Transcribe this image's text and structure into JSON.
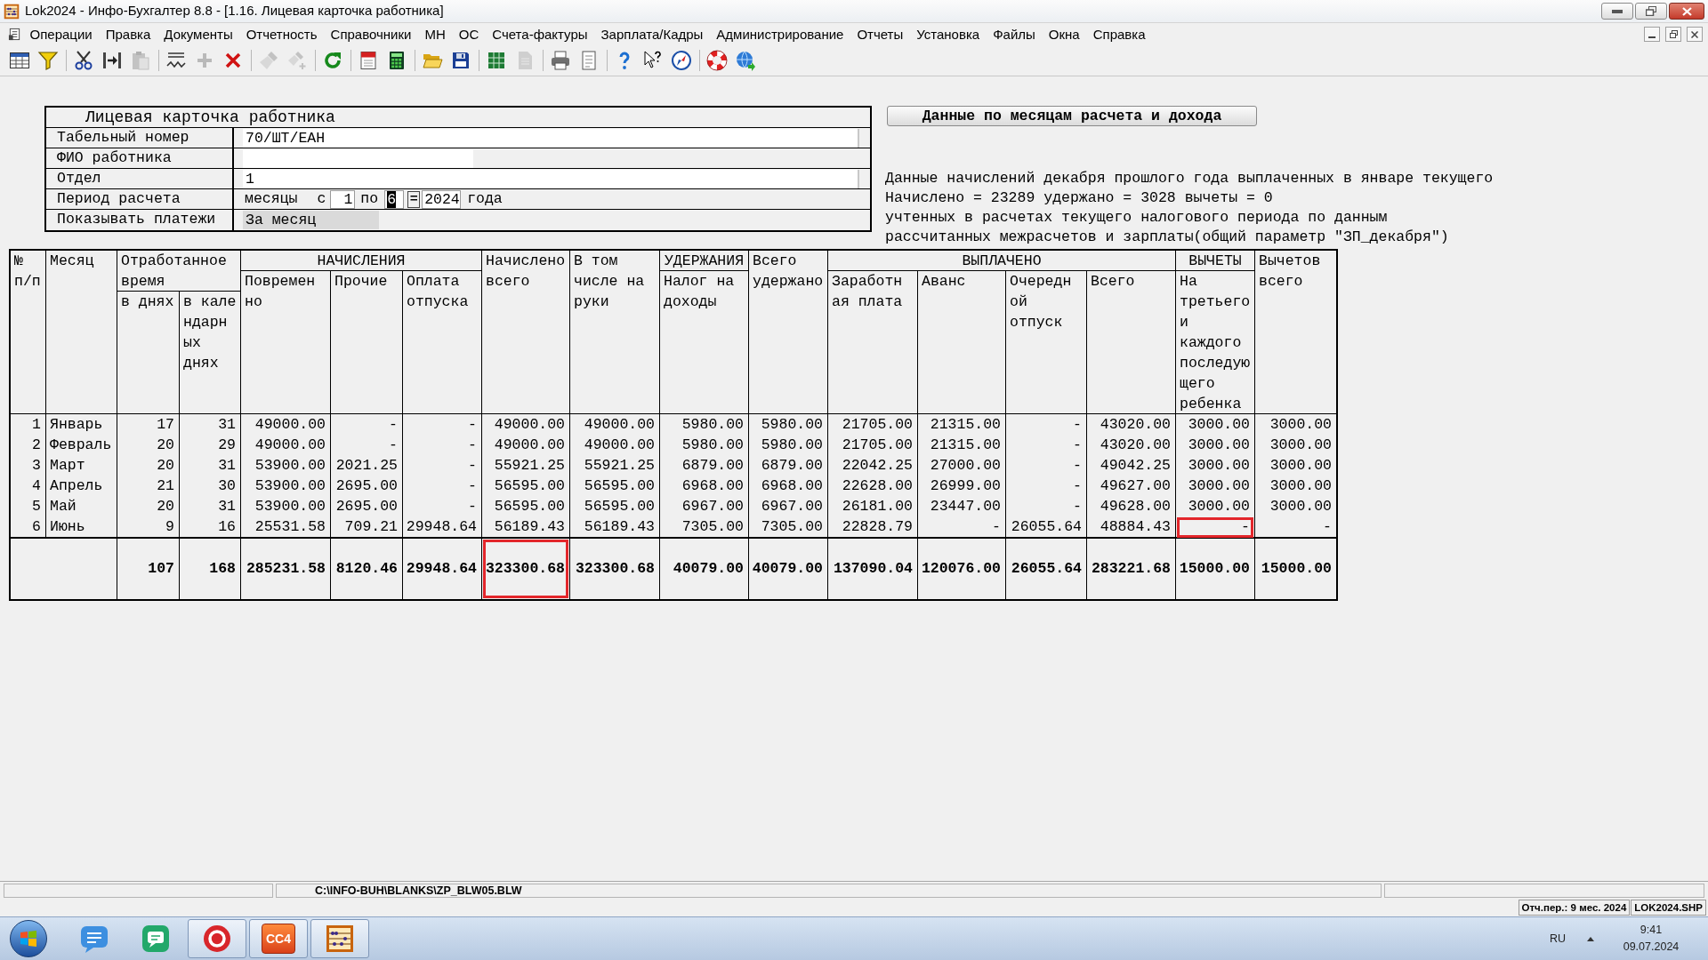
{
  "window": {
    "title": "Lok2024 - Инфо-Бухгалтер 8.8 - [1.16. Лицевая карточка работника]"
  },
  "menu": [
    "Операции",
    "Правка",
    "Документы",
    "Отчетность",
    "Справочники",
    "МН",
    "ОС",
    "Счета-фактуры",
    "Зарплата/Кадры",
    "Администрирование",
    "Отчеты",
    "Установка",
    "Файлы",
    "Окна",
    "Справка"
  ],
  "toolbar": {
    "groups": [
      [
        {
          "disabled": false
        },
        {
          "disabled": false
        }
      ],
      [
        {
          "disabled": false
        },
        {
          "disabled": false
        },
        {
          "disabled": true
        }
      ],
      [
        {
          "disabled": false
        },
        {
          "disabled": true
        },
        {
          "disabled": false
        }
      ],
      [
        {
          "disabled": true
        },
        {
          "disabled": true
        }
      ],
      [
        {
          "disabled": false
        }
      ],
      [
        {
          "disabled": false
        },
        {
          "disabled": false
        }
      ],
      [
        {
          "disabled": false
        },
        {
          "disabled": false
        }
      ],
      [
        {
          "disabled": false
        },
        {
          "disabled": true
        }
      ],
      [
        {
          "disabled": false
        },
        {
          "disabled": false
        }
      ],
      [
        {
          "disabled": false
        },
        {
          "disabled": false
        },
        {
          "disabled": false
        }
      ],
      [
        {
          "disabled": false
        },
        {
          "disabled": false
        }
      ]
    ]
  },
  "form": {
    "title": "Лицевая карточка работника",
    "rows": [
      {
        "kind": "input",
        "label": "Табельный номер",
        "value": "70/ШТ/ЕАН"
      },
      {
        "kind": "blank",
        "label": "ФИО работника"
      },
      {
        "kind": "input",
        "label": "Отдел",
        "value": "1"
      },
      {
        "kind": "period",
        "label": "Период расчета",
        "unit": "месяцы",
        "from_label": "с",
        "from": {
          "value": "1",
          "text_selected": false
        },
        "to_label": "по",
        "to": {
          "value": "6",
          "text_selected": true
        },
        "button": "=",
        "year": {
          "value": "2024",
          "text_selected": false
        },
        "suffix": "года"
      },
      {
        "kind": "select",
        "label": "Показывать платежи",
        "value": "За месяц"
      }
    ]
  },
  "side": {
    "button": "Данные по месяцам расчета и дохода",
    "notes": [
      "Данные начислений декабря прошлого года выплаченных в январе текущего",
      "Начислено = 23289 удержано = 3028 вычеты = 0",
      "учтенных в расчетах текущего налогового периода по данным",
      "рассчитанных межрасчетов и зарплаты(общий параметр \"ЗП_декабря\")"
    ]
  },
  "table": {
    "header": [
      {
        "label": "№\nп/п"
      },
      {
        "label": "Месяц"
      },
      {
        "label": "Отработанное\nвремя",
        "children": [
          {
            "label": "в днях"
          },
          {
            "label": "в кале\nндарн\nых\nднях"
          }
        ]
      },
      {
        "label": "НАЧИСЛЕНИЯ",
        "children": [
          {
            "label": "Повремен\nно"
          },
          {
            "label": "Прочие"
          },
          {
            "label": "Оплата\nотпуска"
          }
        ]
      },
      {
        "label": "Начислено\nвсего"
      },
      {
        "label": "В том\nчисле на\nруки"
      },
      {
        "label": "УДЕРЖАНИЯ",
        "children": [
          {
            "label": "Налог на\nдоходы"
          }
        ]
      },
      {
        "label": "Всего\nудержано"
      },
      {
        "label": "ВЫПЛАЧЕНО",
        "children": [
          {
            "label": "Заработн\nая плата"
          },
          {
            "label": "Аванс"
          },
          {
            "label": "Очередн\nой\nотпуск"
          },
          {
            "label": "Всего"
          }
        ]
      },
      {
        "label": "ВЫЧЕТЫ",
        "children": [
          {
            "label": "На\nтретьего\nи\nкаждого\nпоследую\nщего\nребенка"
          }
        ]
      },
      {
        "label": "Вычетов\nвсего"
      }
    ],
    "rows": [
      {
        "cells": [
          "1",
          "Январь",
          "17",
          "31",
          "49000.00",
          "-",
          "-",
          "49000.00",
          "49000.00",
          "5980.00",
          "5980.00",
          "21705.00",
          "21315.00",
          "-",
          "43020.00",
          "3000.00",
          "3000.00"
        ],
        "framed": [
          false,
          false,
          false,
          false,
          false,
          false,
          false,
          false,
          false,
          false,
          false,
          false,
          false,
          false,
          false,
          false,
          false
        ]
      },
      {
        "cells": [
          "2",
          "Февраль",
          "20",
          "29",
          "49000.00",
          "-",
          "-",
          "49000.00",
          "49000.00",
          "5980.00",
          "5980.00",
          "21705.00",
          "21315.00",
          "-",
          "43020.00",
          "3000.00",
          "3000.00"
        ],
        "framed": [
          false,
          false,
          false,
          false,
          false,
          false,
          false,
          false,
          false,
          false,
          false,
          false,
          false,
          false,
          false,
          false,
          false
        ]
      },
      {
        "cells": [
          "3",
          "Март",
          "20",
          "31",
          "53900.00",
          "2021.25",
          "-",
          "55921.25",
          "55921.25",
          "6879.00",
          "6879.00",
          "22042.25",
          "27000.00",
          "-",
          "49042.25",
          "3000.00",
          "3000.00"
        ],
        "framed": [
          false,
          false,
          false,
          false,
          false,
          false,
          false,
          false,
          false,
          false,
          false,
          false,
          false,
          false,
          false,
          false,
          false
        ]
      },
      {
        "cells": [
          "4",
          "Апрель",
          "21",
          "30",
          "53900.00",
          "2695.00",
          "-",
          "56595.00",
          "56595.00",
          "6968.00",
          "6968.00",
          "22628.00",
          "26999.00",
          "-",
          "49627.00",
          "3000.00",
          "3000.00"
        ],
        "framed": [
          false,
          false,
          false,
          false,
          false,
          false,
          false,
          false,
          false,
          false,
          false,
          false,
          false,
          false,
          false,
          false,
          false
        ]
      },
      {
        "cells": [
          "5",
          "Май",
          "20",
          "31",
          "53900.00",
          "2695.00",
          "-",
          "56595.00",
          "56595.00",
          "6967.00",
          "6967.00",
          "26181.00",
          "23447.00",
          "-",
          "49628.00",
          "3000.00",
          "3000.00"
        ],
        "framed": [
          false,
          false,
          false,
          false,
          false,
          false,
          false,
          false,
          false,
          false,
          false,
          false,
          false,
          false,
          false,
          false,
          false
        ]
      },
      {
        "cells": [
          "6",
          "Июнь",
          "9",
          "16",
          "25531.58",
          "709.21",
          "29948.64",
          "56189.43",
          "56189.43",
          "7305.00",
          "7305.00",
          "22828.79",
          "-",
          "26055.64",
          "48884.43",
          "-",
          "-"
        ],
        "framed": [
          false,
          false,
          false,
          false,
          false,
          false,
          false,
          false,
          false,
          false,
          false,
          false,
          false,
          false,
          false,
          true,
          false
        ]
      }
    ],
    "totals": {
      "cells": [
        "107",
        "168",
        "285231.58",
        "8120.46",
        "29948.64",
        "323300.68",
        "323300.68",
        "40079.00",
        "40079.00",
        "137090.04",
        "120076.00",
        "26055.64",
        "283221.68",
        "15000.00",
        "15000.00"
      ],
      "framed": [
        false,
        false,
        false,
        false,
        false,
        true,
        false,
        false,
        false,
        false,
        false,
        false,
        false,
        false,
        false
      ]
    }
  },
  "status_bar": {
    "path": "C:\\INFO-BUH\\BLANKS\\ZP_BLW05.BLW",
    "period": "Отч.пер.: 9 мес. 2024",
    "file": "LOK2024.SHP"
  },
  "taskbar": {
    "apps": [
      {
        "running": false
      },
      {
        "running": false
      },
      {
        "running": true
      },
      {
        "running": true,
        "logo_text": "CC4"
      },
      {
        "running": true
      }
    ],
    "language": "RU",
    "time": "9:41",
    "date": "09.07.2024"
  }
}
